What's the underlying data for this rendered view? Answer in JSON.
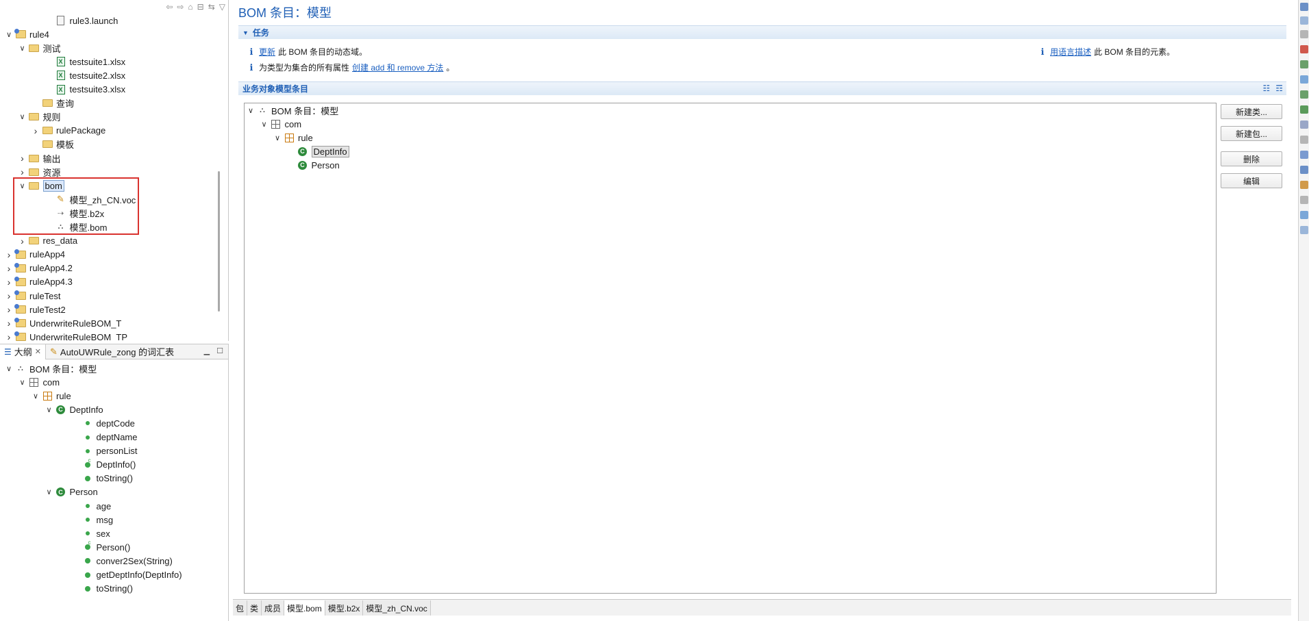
{
  "explorer": {
    "items": [
      {
        "label": "rule3.launch",
        "indent": 3,
        "twisty": "",
        "icon": "launch-file-icon"
      },
      {
        "label": "rule4",
        "indent": 0,
        "twisty": "v",
        "icon": "project-icon"
      },
      {
        "label": "测试",
        "indent": 1,
        "twisty": "v",
        "icon": "folder-icon"
      },
      {
        "label": "testsuite1.xlsx",
        "indent": 3,
        "twisty": "",
        "icon": "excel-file-icon"
      },
      {
        "label": "testsuite2.xlsx",
        "indent": 3,
        "twisty": "",
        "icon": "excel-file-icon"
      },
      {
        "label": "testsuite3.xlsx",
        "indent": 3,
        "twisty": "",
        "icon": "excel-file-icon"
      },
      {
        "label": "查询",
        "indent": 2,
        "twisty": "",
        "icon": "folder-icon"
      },
      {
        "label": "规则",
        "indent": 1,
        "twisty": "v",
        "icon": "folder-icon"
      },
      {
        "label": "rulePackage",
        "indent": 2,
        "twisty": ">",
        "icon": "folder-icon"
      },
      {
        "label": "模板",
        "indent": 2,
        "twisty": "",
        "icon": "folder-icon"
      },
      {
        "label": "输出",
        "indent": 1,
        "twisty": ">",
        "icon": "folder-icon"
      },
      {
        "label": "资源",
        "indent": 1,
        "twisty": ">",
        "icon": "folder-icon"
      },
      {
        "label": "bom",
        "indent": 1,
        "twisty": "v",
        "icon": "folder-icon",
        "selected": true
      },
      {
        "label": "模型_zh_CN.voc",
        "indent": 3,
        "twisty": "",
        "icon": "vocabulary-file-icon"
      },
      {
        "label": "模型.b2x",
        "indent": 3,
        "twisty": "",
        "icon": "b2x-file-icon"
      },
      {
        "label": "模型.bom",
        "indent": 3,
        "twisty": "",
        "icon": "bom-file-icon"
      },
      {
        "label": "res_data",
        "indent": 1,
        "twisty": ">",
        "icon": "folder-icon"
      },
      {
        "label": "ruleApp4",
        "indent": 0,
        "twisty": ">",
        "icon": "project-icon"
      },
      {
        "label": "ruleApp4.2",
        "indent": 0,
        "twisty": ">",
        "icon": "project-icon"
      },
      {
        "label": "ruleApp4.3",
        "indent": 0,
        "twisty": ">",
        "icon": "project-icon"
      },
      {
        "label": "ruleTest",
        "indent": 0,
        "twisty": ">",
        "icon": "project-icon"
      },
      {
        "label": "ruleTest2",
        "indent": 0,
        "twisty": ">",
        "icon": "project-icon"
      },
      {
        "label": "UnderwriteRuleBOM_T",
        "indent": 0,
        "twisty": ">",
        "icon": "project-icon"
      },
      {
        "label": "UnderwriteRuleBOM_TP",
        "indent": 0,
        "twisty": ">",
        "icon": "project-icon"
      }
    ]
  },
  "outline": {
    "tab_outline": "大纲",
    "tab_vocab": "AutoUWRule_zong 的词汇表",
    "items": [
      {
        "label": "BOM 条目：模型",
        "indent": 0,
        "twisty": "v",
        "icon": "bom-icon"
      },
      {
        "label": "com",
        "indent": 1,
        "twisty": "v",
        "icon": "package-icon"
      },
      {
        "label": "rule",
        "indent": 2,
        "twisty": "v",
        "icon": "package-orange-icon"
      },
      {
        "label": "DeptInfo",
        "indent": 3,
        "twisty": "v",
        "icon": "class-icon"
      },
      {
        "label": "deptCode",
        "indent": 5,
        "twisty": "",
        "icon": "field-icon"
      },
      {
        "label": "deptName",
        "indent": 5,
        "twisty": "",
        "icon": "field-icon"
      },
      {
        "label": "personList",
        "indent": 5,
        "twisty": "",
        "icon": "field-icon"
      },
      {
        "label": "DeptInfo()",
        "indent": 5,
        "twisty": "",
        "icon": "constructor-icon"
      },
      {
        "label": "toString()",
        "indent": 5,
        "twisty": "",
        "icon": "method-icon"
      },
      {
        "label": "Person",
        "indent": 3,
        "twisty": "v",
        "icon": "class-icon"
      },
      {
        "label": "age",
        "indent": 5,
        "twisty": "",
        "icon": "field-icon"
      },
      {
        "label": "msg",
        "indent": 5,
        "twisty": "",
        "icon": "field-icon"
      },
      {
        "label": "sex",
        "indent": 5,
        "twisty": "",
        "icon": "field-icon"
      },
      {
        "label": "Person()",
        "indent": 5,
        "twisty": "",
        "icon": "constructor-icon"
      },
      {
        "label": "conver2Sex(String)",
        "indent": 5,
        "twisty": "",
        "icon": "method-icon"
      },
      {
        "label": "getDeptInfo(DeptInfo)",
        "indent": 5,
        "twisty": "",
        "icon": "method-icon"
      },
      {
        "label": "toString()",
        "indent": 5,
        "twisty": "",
        "icon": "method-icon"
      }
    ]
  },
  "editor": {
    "title": "BOM 条目：模型",
    "tasks_header": "任务",
    "task1_link": "更新",
    "task1_text": "此 BOM 条目的动态域。",
    "task2_prefix": "为类型为集合的所有属性",
    "task2_link": "创建 add 和 remove 方法",
    "task2_suffix": "。",
    "task3_link": "用语言描述",
    "task3_text": "此 BOM 条目的元素。",
    "model_header": "业务对象模型条目",
    "tree": [
      {
        "label": "BOM 条目：模型",
        "indent": 0,
        "twisty": "v",
        "icon": "bom-icon"
      },
      {
        "label": "com",
        "indent": 1,
        "twisty": "v",
        "icon": "package-icon"
      },
      {
        "label": "rule",
        "indent": 2,
        "twisty": "v",
        "icon": "package-orange-icon"
      },
      {
        "label": "DeptInfo",
        "indent": 3,
        "twisty": "",
        "icon": "class-icon",
        "selected": true
      },
      {
        "label": "Person",
        "indent": 3,
        "twisty": "",
        "icon": "class-icon"
      }
    ],
    "buttons": {
      "new_class": "新建类...",
      "new_package": "新建包...",
      "delete": "删除",
      "edit": "编辑"
    },
    "bottom_tabs": [
      "包",
      "类",
      "成员",
      "模型.bom",
      "模型.b2x",
      "模型_zh_CN.voc"
    ]
  }
}
